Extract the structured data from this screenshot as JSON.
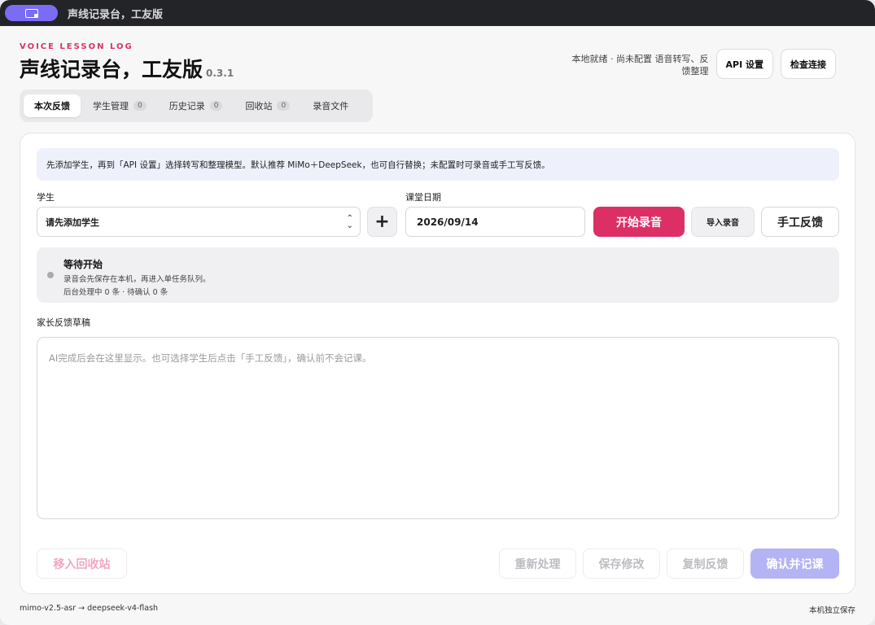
{
  "window": {
    "title": "声线记录台，工友版"
  },
  "header": {
    "eyebrow": "VOICE LESSON LOG",
    "title": "声线记录台，工友版",
    "version": "0.3.1",
    "status_line1": "本地就绪 · 尚未配置 语音转写、反",
    "status_line2": "馈整理",
    "api_settings": "API 设置",
    "check_connection": "检查连接"
  },
  "tabs": [
    {
      "label": "本次反馈"
    },
    {
      "label": "学生管理",
      "count": "0"
    },
    {
      "label": "历史记录",
      "count": "0"
    },
    {
      "label": "回收站",
      "count": "0"
    },
    {
      "label": "录音文件"
    }
  ],
  "notice": "先添加学生，再到「API 设置」选择转写和整理模型。默认推荐 MiMo＋DeepSeek，也可自行替换；未配置时可录音或手工写反馈。",
  "form": {
    "student_label": "学生",
    "student_placeholder": "请先添加学生",
    "add_student": "+",
    "date_label": "课堂日期",
    "date_value": "2026/09/14",
    "start_recording": "开始录音",
    "import_recording": "导入录音",
    "manual_feedback": "手工反馈"
  },
  "status": {
    "title": "等待开始",
    "line1": "录音会先保存在本机，再进入单任务队列。",
    "line2": "后台处理中 0 条 · 待确认 0 条"
  },
  "draft": {
    "label": "家长反馈草稿",
    "placeholder": "AI完成后会在这里显示。也可选择学生后点击「手工反馈」，确认前不会记课。"
  },
  "actions": {
    "move_to_trash": "移入回收站",
    "reprocess": "重新处理",
    "save_changes": "保存修改",
    "copy_feedback": "复制反馈",
    "confirm_record": "确认并记课"
  },
  "footer": {
    "models": "mimo-v2.5-asr → deepseek-v4-flash",
    "storage": "本机独立保存"
  },
  "colors": {
    "accent": "#dc2f66",
    "confirm": "#b4b4f5",
    "title_pill": "#7a6cf5"
  }
}
